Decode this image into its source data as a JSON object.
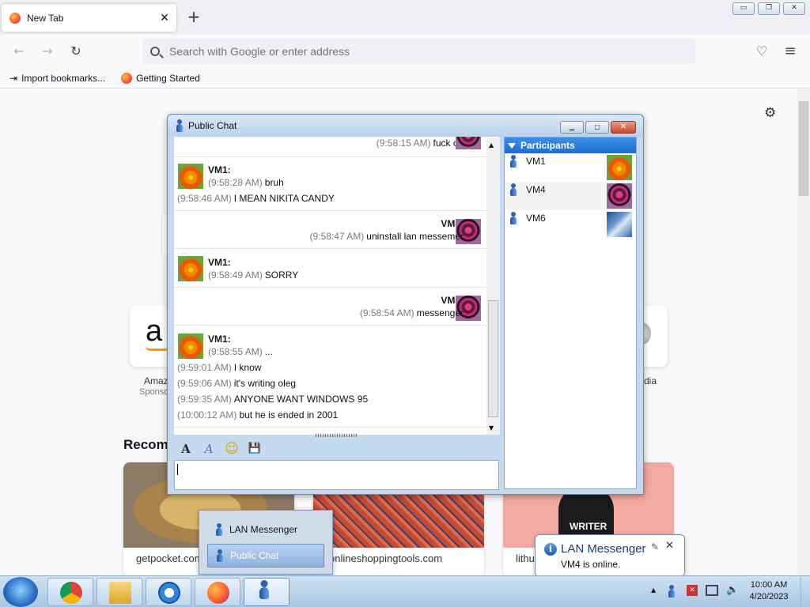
{
  "browser": {
    "tab_title": "New Tab",
    "tab_close": "✕",
    "new_tab": "+",
    "search_placeholder": "Search with Google or enter address",
    "bookmarks": [
      "Import bookmarks...",
      "Getting Started"
    ],
    "window_controls": {
      "minimize": "▭",
      "restore": "❐",
      "close": "✕"
    },
    "nav": {
      "back": "←",
      "forward": "→",
      "reload": "↻",
      "pocket": "♡",
      "menu": "≡"
    },
    "settings_icon": "⚙"
  },
  "newtab": {
    "tiles": [
      {
        "name": "Amaz",
        "sub": "Sponso",
        "glyph": "a"
      },
      {
        "name": "dia",
        "sub": "",
        "glyph": ""
      }
    ],
    "recommended_heading": "Recomm",
    "cards": [
      {
        "source": "getpocket.com",
        "color": "#b88a4a"
      },
      {
        "source": "onlineshoppingtools.com",
        "color": "#c0442f"
      },
      {
        "source": "lithu",
        "color": "#f4a9a0",
        "caption": "WRITER"
      }
    ]
  },
  "chat": {
    "window_title": "Public Chat",
    "messages": [
      {
        "sender": "",
        "side": "right",
        "lines": [
          {
            "time": "(9:58:15 AM)",
            "text": "fuck off"
          }
        ]
      },
      {
        "sender": "VM1:",
        "side": "left",
        "lines": [
          {
            "time": "(9:58:28 AM)",
            "text": "bruh"
          },
          {
            "time": "(9:58:46 AM)",
            "text": "I MEAN NIKITA CANDY"
          }
        ]
      },
      {
        "sender": "VM4:",
        "side": "right",
        "lines": [
          {
            "time": "(9:58:47 AM)",
            "text": "uninstall lan messemer"
          }
        ]
      },
      {
        "sender": "VM1:",
        "side": "left",
        "lines": [
          {
            "time": "(9:58:49 AM)",
            "text": "SORRY"
          }
        ]
      },
      {
        "sender": "VM4:",
        "side": "right",
        "lines": [
          {
            "time": "(9:58:54 AM)",
            "text": "messenger"
          }
        ]
      },
      {
        "sender": "VM1:",
        "side": "left",
        "lines": [
          {
            "time": "(9:58:55 AM)",
            "text": "..."
          },
          {
            "time": "(9:59:01 AM)",
            "text": "I know"
          },
          {
            "time": "(9:59:06 AM)",
            "text": "it's writing oleg"
          },
          {
            "time": "(9:59:35 AM)",
            "text": "ANYONE WANT WINDOWS 95"
          },
          {
            "time": "(10:00:12 AM)",
            "text": "but he is ended in 2001"
          }
        ]
      }
    ],
    "format_toolbar": {
      "font": "A",
      "font_color": "A",
      "emoji": "☺",
      "save": "💾"
    },
    "input_value": "",
    "participants_header": "Participants",
    "participants": [
      {
        "name": "VM1",
        "avatar": "vm1"
      },
      {
        "name": "VM4",
        "avatar": "vm4"
      },
      {
        "name": "VM6",
        "avatar": "vm6"
      }
    ]
  },
  "jump_list": {
    "items": [
      "LAN Messenger",
      "Public Chat"
    ]
  },
  "notification": {
    "title": "LAN Messenger",
    "body": "VM4 is online.",
    "close": "✕"
  },
  "taskbar": {
    "apps": [
      "chrome",
      "explorer",
      "internet-explorer",
      "firefox",
      "lan-messenger"
    ],
    "clock_time": "10:00 AM",
    "clock_date": "4/20/2023",
    "tray_arrow": "▲"
  }
}
